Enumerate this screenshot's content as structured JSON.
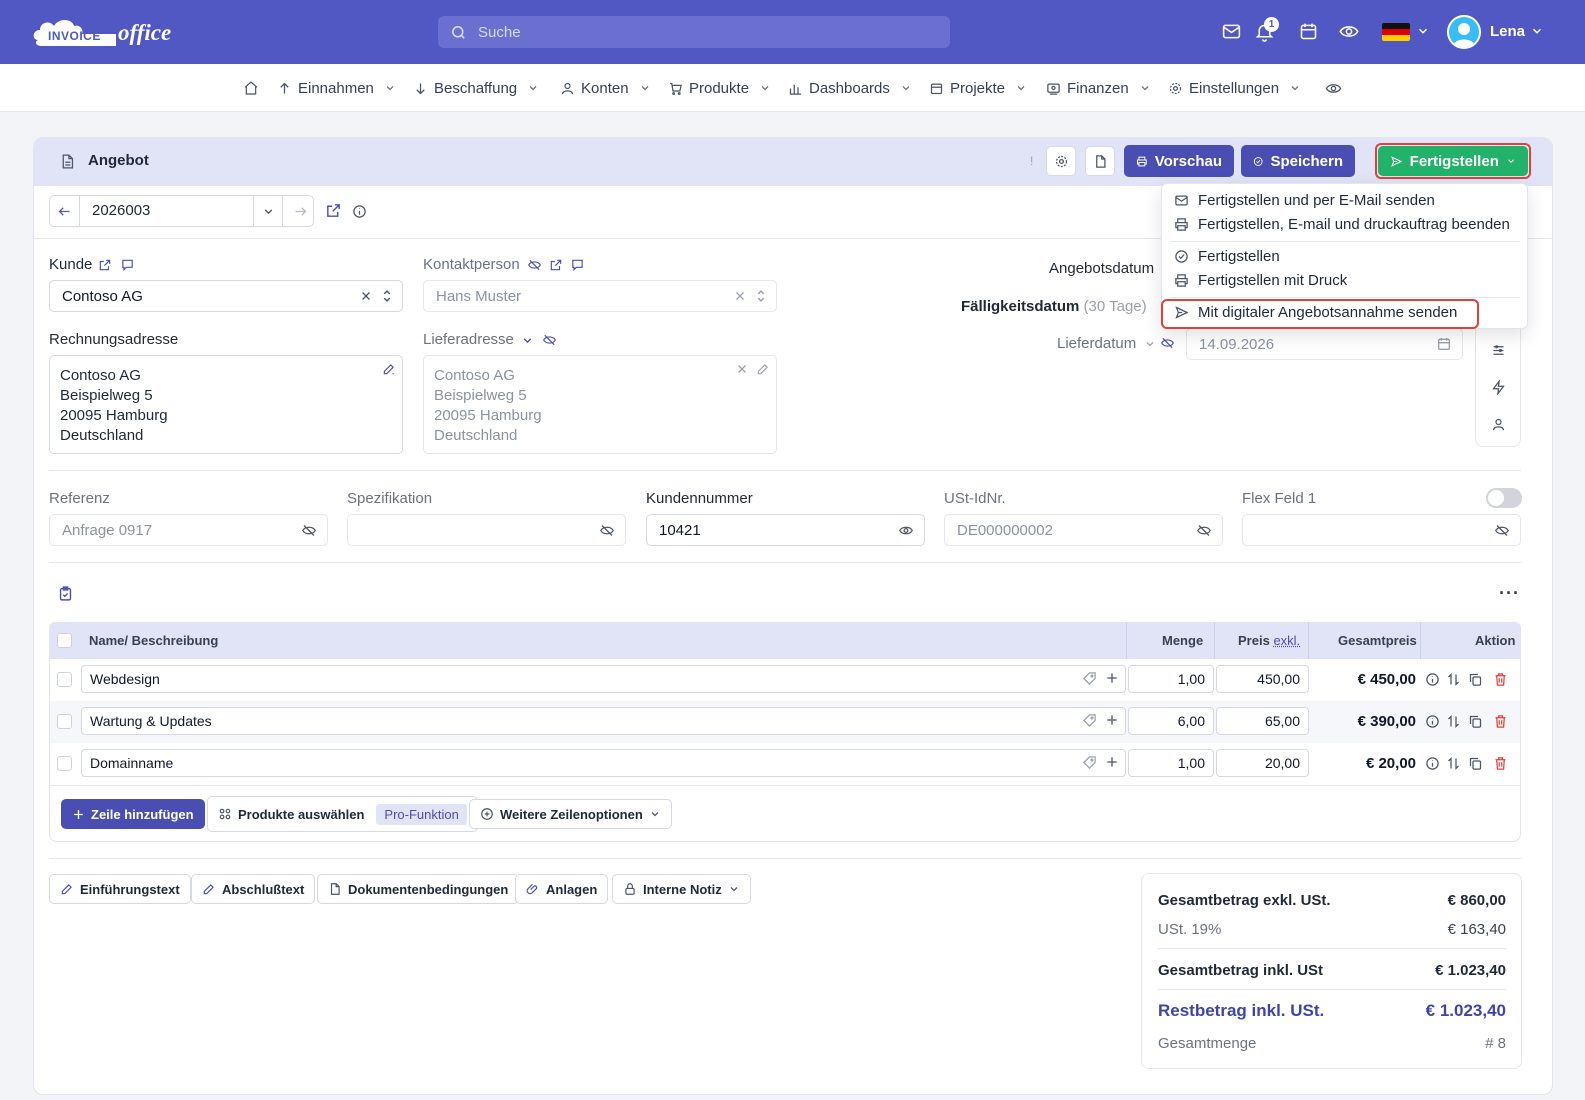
{
  "app": {
    "logo_word1": "INVOICE",
    "logo_word2": "office",
    "search_placeholder": "Suche",
    "notification_count": "1",
    "user_name": "Lena",
    "accent": "#5157c3"
  },
  "nav": {
    "items": [
      {
        "label": "Einnahmen",
        "icon": "arrow-up-icon"
      },
      {
        "label": "Beschaffung",
        "icon": "arrow-down-icon"
      },
      {
        "label": "Konten",
        "icon": "user-icon"
      },
      {
        "label": "Produkte",
        "icon": "cart-icon"
      },
      {
        "label": "Dashboards",
        "icon": "bar-chart-icon"
      },
      {
        "label": "Projekte",
        "icon": "calendar-icon"
      },
      {
        "label": "Finanzen",
        "icon": "finance-icon"
      },
      {
        "label": "Einstellungen",
        "icon": "gear-icon"
      }
    ]
  },
  "doc": {
    "title": "Angebot",
    "btn_preview": "Vorschau",
    "btn_save": "Speichern",
    "btn_finish": "Fertigstellen",
    "number": "2026003"
  },
  "dropdown": {
    "items": [
      "Fertigstellen und per E-Mail senden",
      "Fertigstellen, E-mail und druckauftrag beenden",
      "Fertigstellen",
      "Fertigstellen mit Druck",
      "Mit digitaler Angebotsannahme senden"
    ]
  },
  "form": {
    "kunde_label": "Kunde",
    "kunde_value": "Contoso AG",
    "kontakt_label": "Kontaktperson",
    "kontakt_value": "Hans Muster",
    "rechnung_label": "Rechnungsadresse",
    "rechnung_lines": [
      "Contoso AG",
      "Beispielweg 5",
      "20095 Hamburg",
      "Deutschland"
    ],
    "liefer_label": "Lieferadresse",
    "liefer_lines": [
      "Contoso AG",
      "Beispielweg 5",
      "20095 Hamburg",
      "Deutschland"
    ],
    "angebotsdatum_label": "Angebotsdatum",
    "faellig_label": "Fälligkeitsdatum",
    "faellig_note": "(30 Tage)",
    "lieferdatum_label": "Lieferdatum",
    "lieferdatum_value": "14.09.2026",
    "referenz_label": "Referenz",
    "referenz_value": "Anfrage 0917",
    "spez_label": "Spezifikation",
    "spez_value": "",
    "kundennr_label": "Kundennummer",
    "kundennr_value": "10421",
    "ustid_label": "USt-IdNr.",
    "ustid_value": "DE000000002",
    "flex_label": "Flex Feld 1",
    "flex_value": ""
  },
  "table": {
    "col_name": "Name/ Beschreibung",
    "col_qty": "Menge",
    "col_price": "Preis",
    "col_price_note": "exkl.",
    "col_total": "Gesamtpreis",
    "col_action": "Aktion",
    "rows": [
      {
        "name": "Webdesign",
        "qty": "1,00",
        "price": "450,00",
        "total": "€ 450,00"
      },
      {
        "name": "Wartung & Updates",
        "qty": "6,00",
        "price": "65,00",
        "total": "€ 390,00"
      },
      {
        "name": "Domainname",
        "qty": "1,00",
        "price": "20,00",
        "total": "€ 20,00"
      }
    ],
    "btn_add_row": "Zeile hinzufügen",
    "btn_products": "Produkte auswählen",
    "pro_tag": "Pro-Funktion",
    "btn_more_rows": "Weitere Zeilenoptionen"
  },
  "footer_buttons": [
    "Einführungstext",
    "Abschlußtext",
    "Dokumentenbedingungen",
    "Anlagen",
    "Interne Notiz"
  ],
  "totals": {
    "net_label": "Gesamtbetrag exkl. USt.",
    "net_value": "€ 860,00",
    "vat_label": "USt. 19%",
    "vat_value": "€ 163,40",
    "gross_label": "Gesamtbetrag inkl. USt",
    "gross_value": "€ 1.023,40",
    "rest_label": "Restbetrag inkl. USt.",
    "rest_value": "€ 1.023,40",
    "qty_label": "Gesamtmenge",
    "qty_value": "# 8"
  }
}
